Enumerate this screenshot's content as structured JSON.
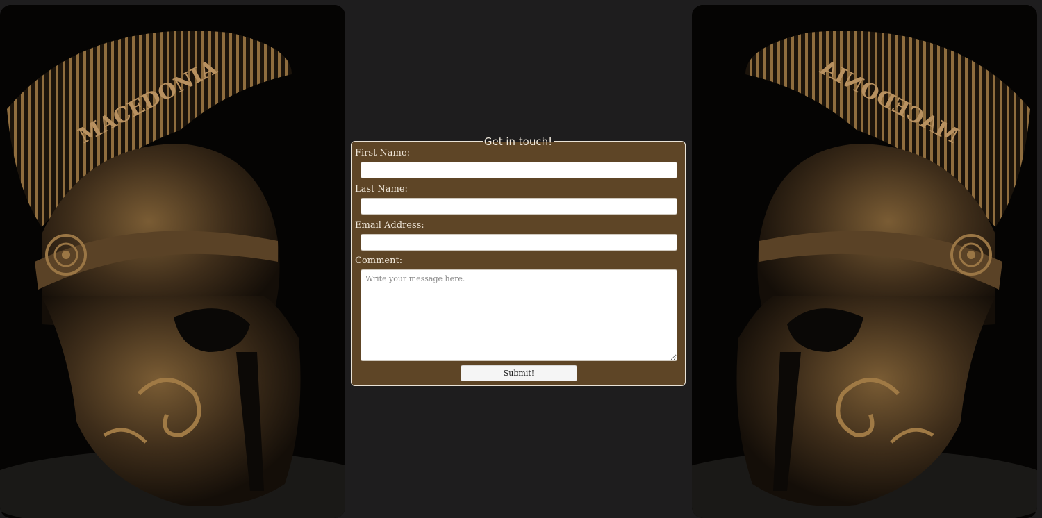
{
  "form": {
    "legend": "Get in touch!",
    "first_name_label": "First Name:",
    "first_name_value": "",
    "last_name_label": "Last Name:",
    "last_name_value": "",
    "email_label": "Email Address:",
    "email_value": "",
    "comment_label": "Comment:",
    "comment_placeholder": "Write your message here.",
    "submit_label": "Submit!"
  },
  "images": {
    "left": "spartan-helmet-image",
    "right": "spartan-helmet-image-mirrored",
    "helmet_inscription": "MACEDONIA"
  },
  "colors": {
    "page_background": "#1e1d1e",
    "form_background": "#5e4526",
    "form_border": "#e9e2d6",
    "bronze": "#8a6a3c"
  }
}
